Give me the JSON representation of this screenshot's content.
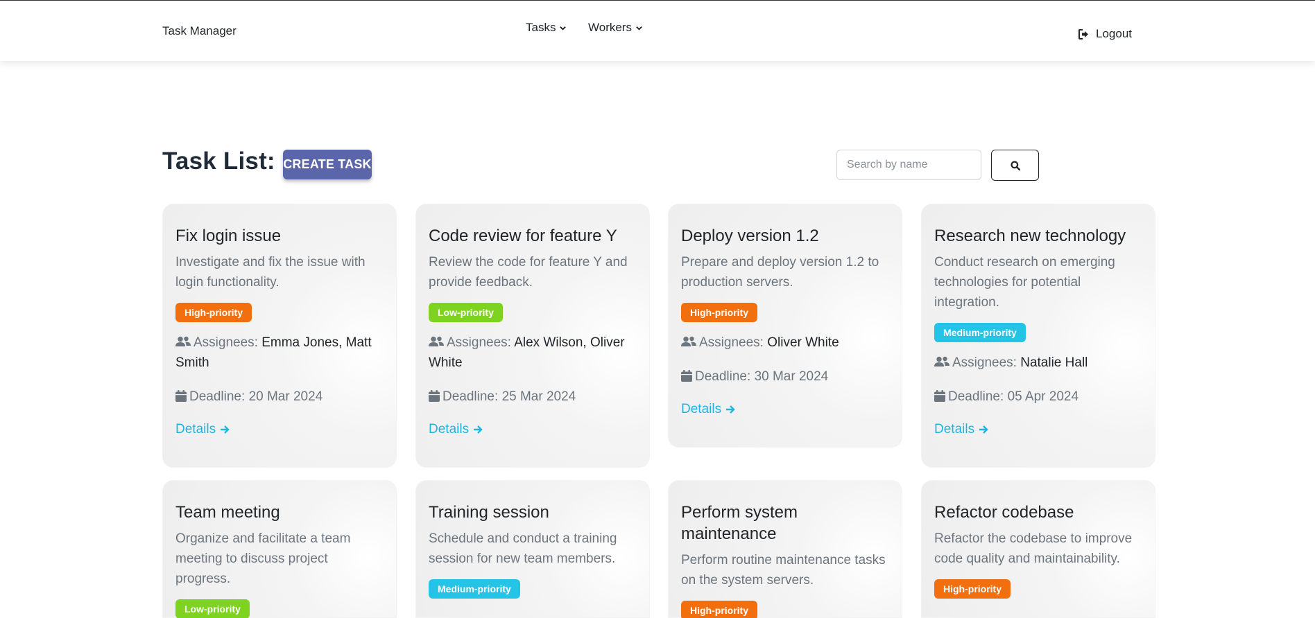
{
  "navbar": {
    "brand": "Task Manager",
    "tasks_label": "Tasks",
    "workers_label": "Workers",
    "logout_label": "Logout"
  },
  "header": {
    "title": "Task List:",
    "create_label": "CREATE TASK",
    "search_placeholder": "Search by name"
  },
  "labels": {
    "assignees": "Assignees:",
    "deadline": "Deadline:",
    "details": "Details"
  },
  "colors": {
    "high": "#f26f0f",
    "low": "#7ed321",
    "medium": "#25c3e6",
    "link": "#1eb5e0",
    "create_button": "#5b65a9"
  },
  "tasks": [
    {
      "title": "Fix login issue",
      "description": "Investigate and fix the issue with login functionality.",
      "priority": "High-priority",
      "assignees": "Emma Jones, Matt Smith",
      "deadline": "20 Mar 2024"
    },
    {
      "title": "Code review for feature Y",
      "description": "Review the code for feature Y and provide feedback.",
      "priority": "Low-priority",
      "assignees": "Alex Wilson, Oliver White",
      "deadline": "25 Mar 2024"
    },
    {
      "title": "Deploy version 1.2",
      "description": "Prepare and deploy version 1.2 to production servers.",
      "priority": "High-priority",
      "assignees": "Oliver White",
      "deadline": "30 Mar 2024"
    },
    {
      "title": "Research new technology",
      "description": "Conduct research on emerging technologies for potential integration.",
      "priority": "Medium-priority",
      "assignees": "Natalie Hall",
      "deadline": "05 Apr 2024"
    },
    {
      "title": "Team meeting",
      "description": "Organize and facilitate a team meeting to discuss project progress.",
      "priority": "Low-priority"
    },
    {
      "title": "Training session",
      "description": "Schedule and conduct a training session for new team members.",
      "priority": "Medium-priority"
    },
    {
      "title": "Perform system maintenance",
      "description": "Perform routine maintenance tasks on the system servers.",
      "priority": "High-priority"
    },
    {
      "title": "Refactor codebase",
      "description": "Refactor the codebase to improve code quality and maintainability.",
      "priority": "High-priority"
    }
  ]
}
